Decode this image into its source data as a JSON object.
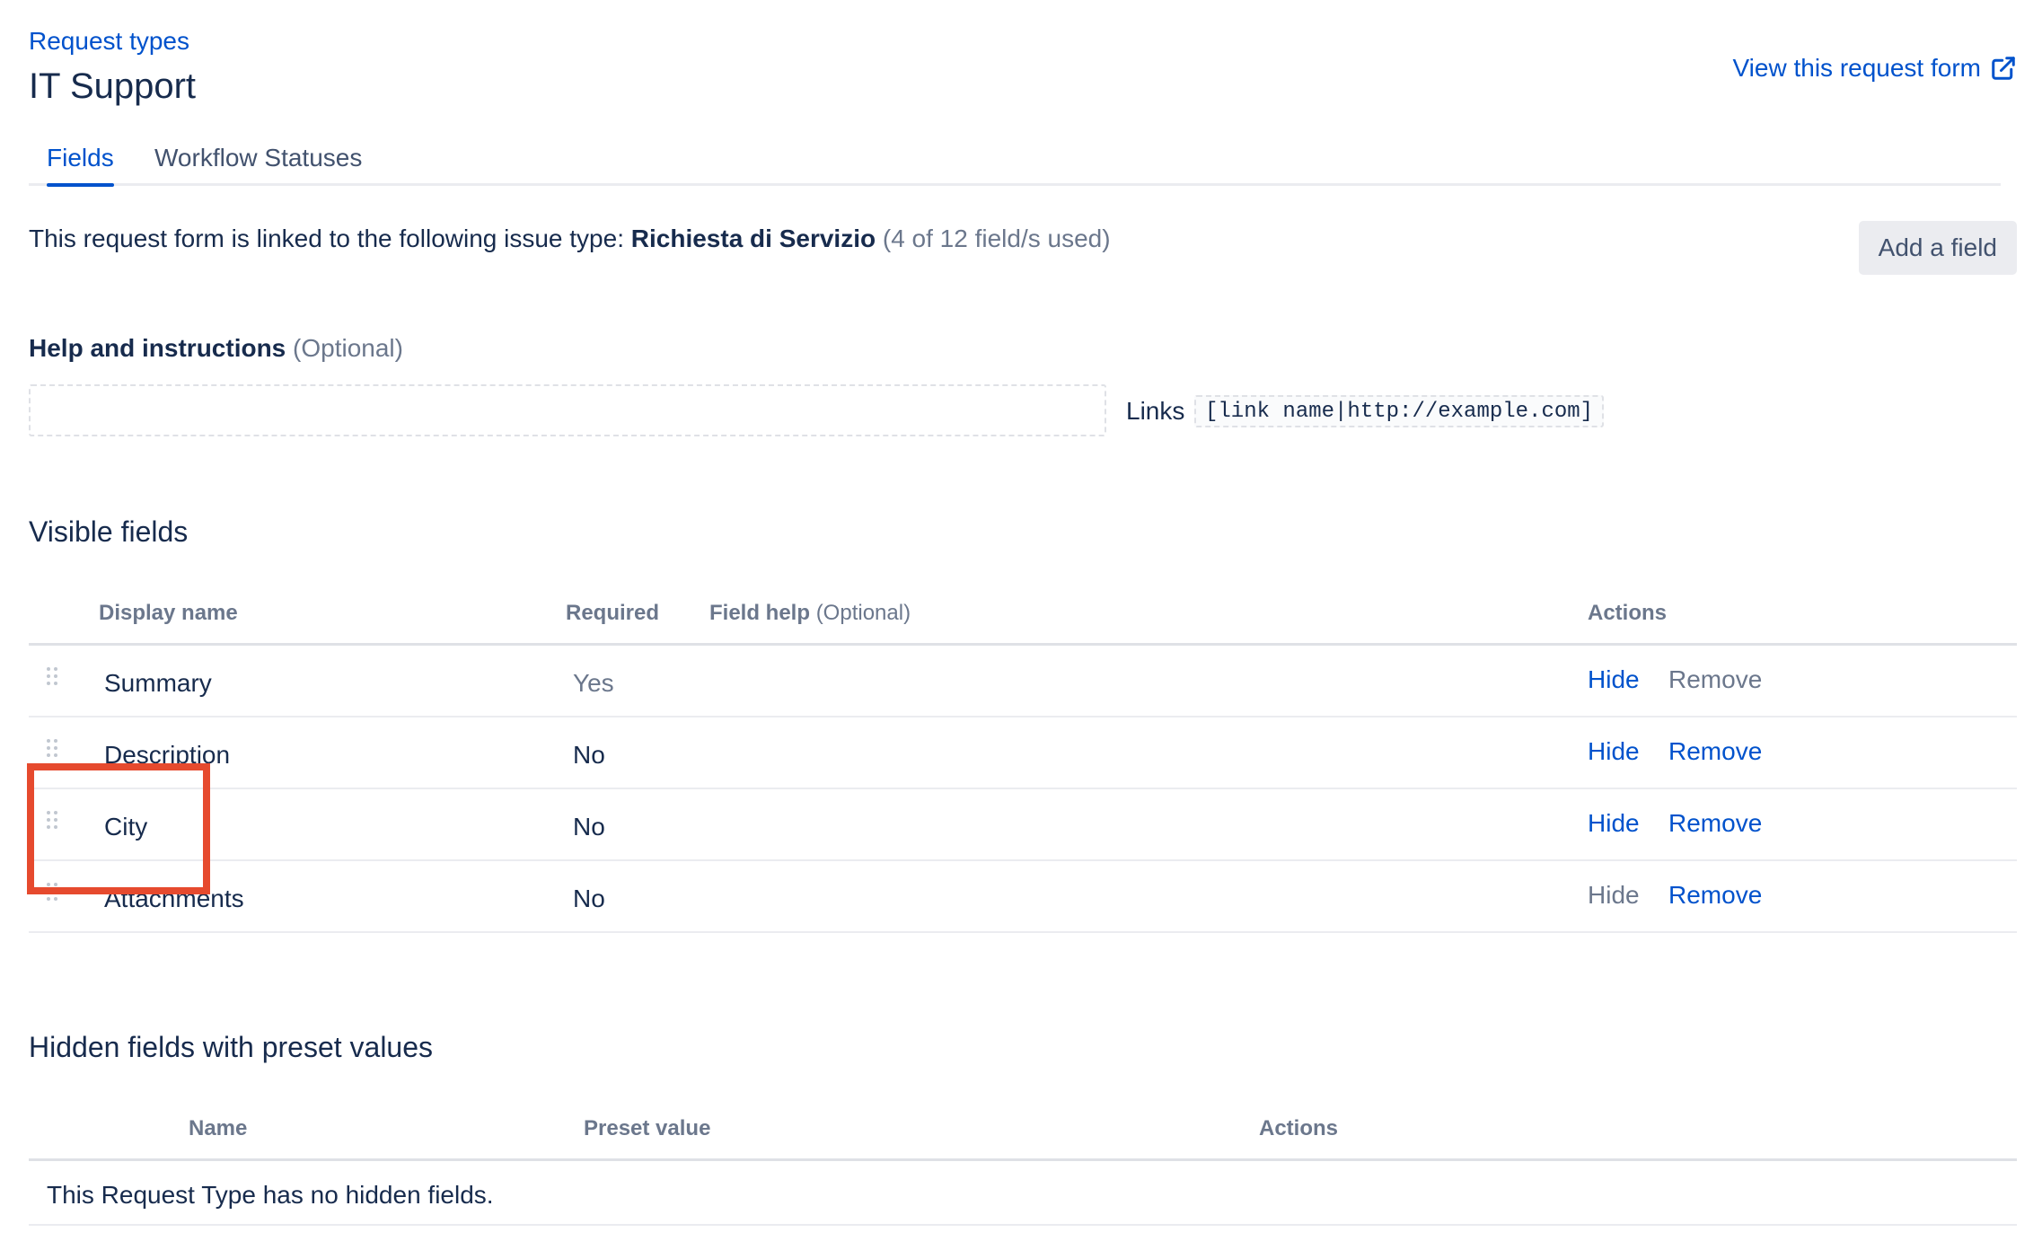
{
  "header": {
    "breadcrumb": "Request types",
    "title": "IT Support",
    "view_form_label": "View this request form"
  },
  "tabs": [
    {
      "label": "Fields",
      "active": true
    },
    {
      "label": "Workflow Statuses",
      "active": false
    }
  ],
  "linked": {
    "prefix": "This request form is linked to the following issue type:",
    "issue_type": "Richiesta di Servizio",
    "usage": "(4 of 12 field/s used)"
  },
  "add_field_label": "Add a field",
  "help": {
    "label": "Help and instructions",
    "optional": "(Optional)",
    "input_value": "",
    "links_label": "Links",
    "links_syntax": "[link name|http://example.com]"
  },
  "visible_fields": {
    "title": "Visible fields",
    "columns": {
      "display_name": "Display name",
      "required": "Required",
      "field_help": "Field help",
      "field_help_optional": "(Optional)",
      "actions": "Actions"
    },
    "rows": [
      {
        "name": "Summary",
        "required": "Yes",
        "hide": "Hide",
        "remove": "Remove",
        "hide_enabled": true,
        "remove_enabled": false
      },
      {
        "name": "Description",
        "required": "No",
        "hide": "Hide",
        "remove": "Remove",
        "hide_enabled": true,
        "remove_enabled": true
      },
      {
        "name": "City",
        "required": "No",
        "hide": "Hide",
        "remove": "Remove",
        "hide_enabled": true,
        "remove_enabled": true
      },
      {
        "name": "Attachments",
        "required": "No",
        "hide": "Hide",
        "remove": "Remove",
        "hide_enabled": false,
        "remove_enabled": true
      }
    ]
  },
  "hidden_fields": {
    "title": "Hidden fields with preset values",
    "columns": {
      "name": "Name",
      "preset_value": "Preset value",
      "actions": "Actions"
    },
    "empty_message": "This Request Type has no hidden fields."
  },
  "colors": {
    "link": "#0052cc",
    "text": "#172b4d",
    "muted": "#6b778c",
    "highlight": "#e64a2e"
  },
  "icons": {
    "external_link": "external-link-icon",
    "drag_handle": "drag-handle-icon"
  }
}
